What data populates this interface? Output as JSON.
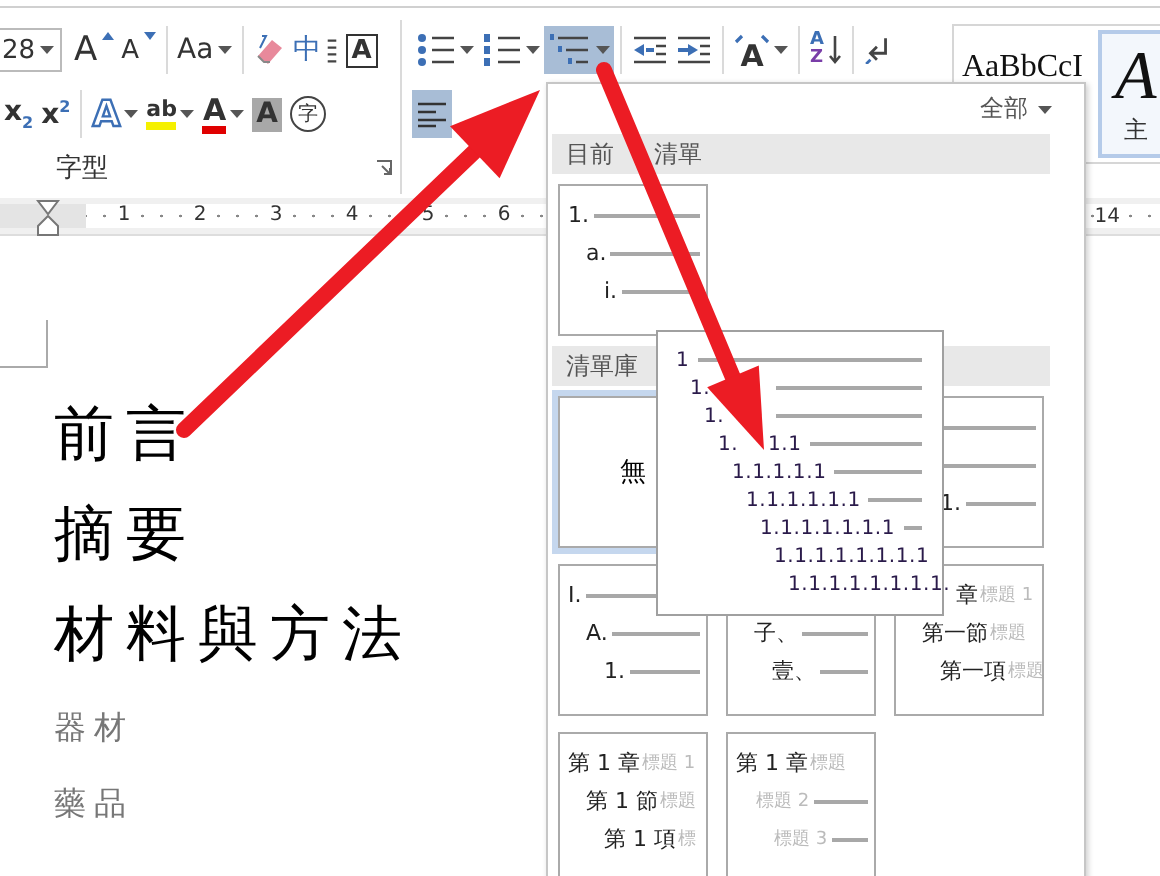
{
  "ribbon": {
    "font_group": {
      "font_size": "28",
      "row1": [
        {
          "kind": "grow-font",
          "glyph": "A",
          "dropdown": false,
          "selected": false
        },
        {
          "kind": "shrink-font",
          "glyph": "A",
          "dropdown": false,
          "selected": false
        },
        {
          "kind": "divider"
        },
        {
          "kind": "change-case",
          "glyph": "Aa",
          "dropdown": true,
          "selected": false
        },
        {
          "kind": "divider"
        },
        {
          "kind": "clear-format",
          "dropdown": false,
          "selected": false
        },
        {
          "kind": "phonetic",
          "glyph": "中",
          "dropdown": false,
          "selected": false
        },
        {
          "kind": "char-border",
          "glyph": "A",
          "dropdown": false,
          "selected": false
        }
      ],
      "row2": [
        {
          "kind": "subscript",
          "glyph": "x$_{2}$",
          "dropdown": false,
          "selected": false
        },
        {
          "kind": "superscript",
          "glyph": "x$^{2}$",
          "dropdown": false,
          "selected": false
        },
        {
          "kind": "divider"
        },
        {
          "kind": "text-effect",
          "glyph": "A",
          "dropdown": true,
          "selected": false
        },
        {
          "kind": "highlight",
          "glyph": "ab",
          "dropdown": true,
          "selected": false
        },
        {
          "kind": "font-color",
          "glyph": "A",
          "dropdown": true,
          "selected": false
        },
        {
          "kind": "char-shading",
          "glyph": "A",
          "dropdown": false,
          "selected": false
        },
        {
          "kind": "enclose",
          "glyph": "字",
          "dropdown": false,
          "selected": false
        }
      ],
      "label": "字型"
    },
    "paragraph_group": {
      "row1": [
        {
          "kind": "bullets",
          "dropdown": true,
          "selected": false
        },
        {
          "kind": "numbering",
          "dropdown": true,
          "selected": false
        },
        {
          "kind": "multilevel",
          "dropdown": true,
          "selected": true
        },
        {
          "kind": "divider"
        },
        {
          "kind": "decrease-indent",
          "dropdown": false,
          "selected": false
        },
        {
          "kind": "increase-indent",
          "dropdown": false,
          "selected": false
        },
        {
          "kind": "divider"
        },
        {
          "kind": "asian-layout",
          "glyph": "A",
          "dropdown": true,
          "selected": false
        },
        {
          "kind": "divider"
        },
        {
          "kind": "sort",
          "glyphs": [
            "A",
            "Z"
          ],
          "dropdown": false,
          "selected": false
        },
        {
          "kind": "divider"
        },
        {
          "kind": "show-marks",
          "dropdown": false,
          "selected": false
        }
      ],
      "row2": [
        {
          "kind": "align-left",
          "dropdown": false,
          "selected": true
        }
      ]
    },
    "styles": [
      {
        "sample": "AaBbCcI",
        "selected": false
      },
      {
        "sample": "A",
        "caption": "主",
        "selected": true
      }
    ]
  },
  "ruler": {
    "numbers": [
      "1",
      "2",
      "3",
      "4",
      "5",
      "6"
    ],
    "right_number": "14"
  },
  "document": {
    "headings": [
      "前言",
      "摘要",
      "材料與方法"
    ],
    "subheadings": [
      "器材",
      "藥品"
    ]
  },
  "list_menu": {
    "filter": "全部",
    "sections": [
      {
        "title": "目前",
        "title_tail": "清單",
        "thumbnails": [
          {
            "kind": "outline",
            "selected": false,
            "levels": [
              {
                "label": "1.",
                "line": true
              },
              {
                "label": "a.",
                "line": true
              },
              {
                "label": "i.",
                "line": true
              }
            ]
          }
        ]
      },
      {
        "title": "清單庫",
        "thumbnails": [
          {
            "kind": "none",
            "label": "無",
            "selected": true
          },
          {
            "kind": "covered"
          },
          {
            "kind": "outline",
            "selected": false,
            "levels": [
              {
                "line": true
              },
              {
                "line": true
              },
              {
                "label": "1.",
                "line": true
              }
            ]
          },
          {
            "kind": "outline",
            "selected": false,
            "levels": [
              {
                "label": "I.",
                "line": true
              },
              {
                "label": "A.",
                "line": true
              },
              {
                "label": "1.",
                "line": true
              }
            ]
          },
          {
            "kind": "outline",
            "selected": false,
            "top_covered": true,
            "levels": [
              {
                "label": "子、",
                "line": true
              },
              {
                "label": "壹、",
                "line": true
              }
            ]
          },
          {
            "kind": "outline",
            "selected": false,
            "levels": [
              {
                "label": "章",
                "hint": "標題 1",
                "covered": true,
                "line": false
              },
              {
                "label": "第一節",
                "hint": "標題",
                "line": false
              },
              {
                "label": "第一項",
                "hint": "標題",
                "line": false
              }
            ]
          },
          {
            "kind": "outline",
            "selected": false,
            "levels": [
              {
                "label": "第 1 章",
                "hint": "標題 1",
                "line": false
              },
              {
                "label": "第 1 節",
                "hint": "標題",
                "line": false
              },
              {
                "label": "第 1 項",
                "hint": "標",
                "line": false
              }
            ]
          },
          {
            "kind": "outline",
            "selected": false,
            "levels": [
              {
                "label": "第 1 章",
                "hint": "標題",
                "line": false
              },
              {
                "hint": "標題 2",
                "line": true
              },
              {
                "hint": "標題 3",
                "line": true
              }
            ]
          }
        ]
      }
    ]
  },
  "preview": {
    "levels": [
      {
        "label": "1",
        "line": true
      },
      {
        "label": "1.",
        "covered": true,
        "line": true
      },
      {
        "label": "1.",
        "covered": true,
        "line": true
      },
      {
        "label": "1.",
        "covered": true,
        "tail": "1.1",
        "line": true
      },
      {
        "label": "1.1.1.1.1",
        "line": true
      },
      {
        "label": "1.1.1.1.1.1",
        "line": true
      },
      {
        "label": "1.1.1.1.1.1.1",
        "line": true
      },
      {
        "label": "1.1.1.1.1.1.1.1",
        "line": false
      },
      {
        "label": "1.1.1.1.1.1.1.1.",
        "line": false
      }
    ]
  }
}
